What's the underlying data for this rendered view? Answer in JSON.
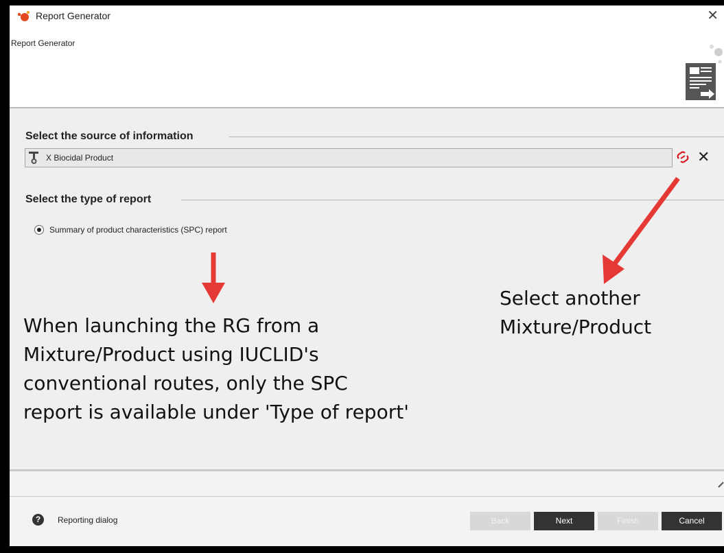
{
  "window": {
    "title": "Report Generator",
    "close_glyph": "✕"
  },
  "header": {
    "subtitle": "Report Generator",
    "icon": "report-document-icon"
  },
  "source_section": {
    "title": "Select the source of information",
    "value": "X Biocidal Product",
    "value_icon": "mixture-product-icon",
    "link_icon": "link-icon",
    "clear_glyph": "✕"
  },
  "type_section": {
    "title": "Select the type of report",
    "options": [
      {
        "label": "Summary of product characteristics (SPC) report",
        "selected": true
      }
    ]
  },
  "annotations": {
    "main_lines": [
      "When launching the RG from a",
      "Mixture/Product using IUCLID's",
      "conventional routes, only the SPC",
      "report is available under 'Type of report'"
    ],
    "right_lines": [
      "Select another",
      "Mixture/Product"
    ],
    "arrow_color": "#e53935"
  },
  "footer": {
    "help_glyph": "?",
    "label": "Reporting dialog",
    "buttons": {
      "back": "Back",
      "next": "Next",
      "finish": "Finish",
      "cancel": "Cancel"
    }
  },
  "colors": {
    "content_bg": "#efefef",
    "button_dark": "#333333",
    "button_disabled": "#d8d8d8"
  }
}
